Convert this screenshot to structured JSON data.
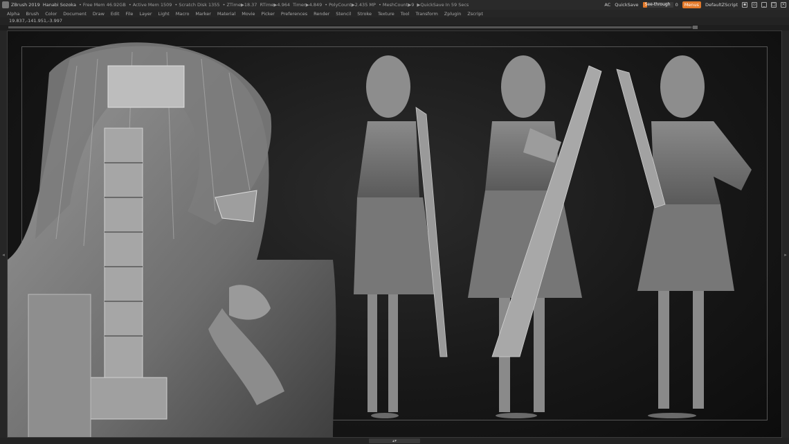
{
  "titlebar": {
    "app": "ZBrush 2019",
    "file": "Hanabi Sozoka",
    "stats": [
      "• Free Mem 46.92GB",
      "• Active Mem 1509",
      "• Scratch Disk 1355",
      "• ZTime▶18.37",
      "RTime▶4.964",
      "Timer▶4.849",
      "• PolyCount▶2.435 MP",
      "• MeshCount▶9",
      "▶QuickSave In 59 Secs"
    ],
    "ac": "AC",
    "quicksave": "QuickSave",
    "seethrough_label": "See-through",
    "seethrough_value": "0",
    "seethrough_level": 0.15,
    "menus": "Menus",
    "script": "DefaultZScript"
  },
  "menubar": [
    "Alpha",
    "Brush",
    "Color",
    "Document",
    "Draw",
    "Edit",
    "File",
    "Layer",
    "Light",
    "Macro",
    "Marker",
    "Material",
    "Movie",
    "Picker",
    "Preferences",
    "Render",
    "Stencil",
    "Stroke",
    "Texture",
    "Tool",
    "Transform",
    "Zplugin",
    "Zscript"
  ],
  "coords": "19.837,-141.951,-3.997",
  "progress": 0.99,
  "colors": {
    "accent": "#e2792a",
    "bg": "#1e1e1e",
    "canvas": "#181818"
  },
  "icons": [
    "logo-icon",
    "window-icon",
    "layout-icon",
    "minimize-icon",
    "maximize-icon",
    "close-icon",
    "collapse-arrow-icon"
  ]
}
